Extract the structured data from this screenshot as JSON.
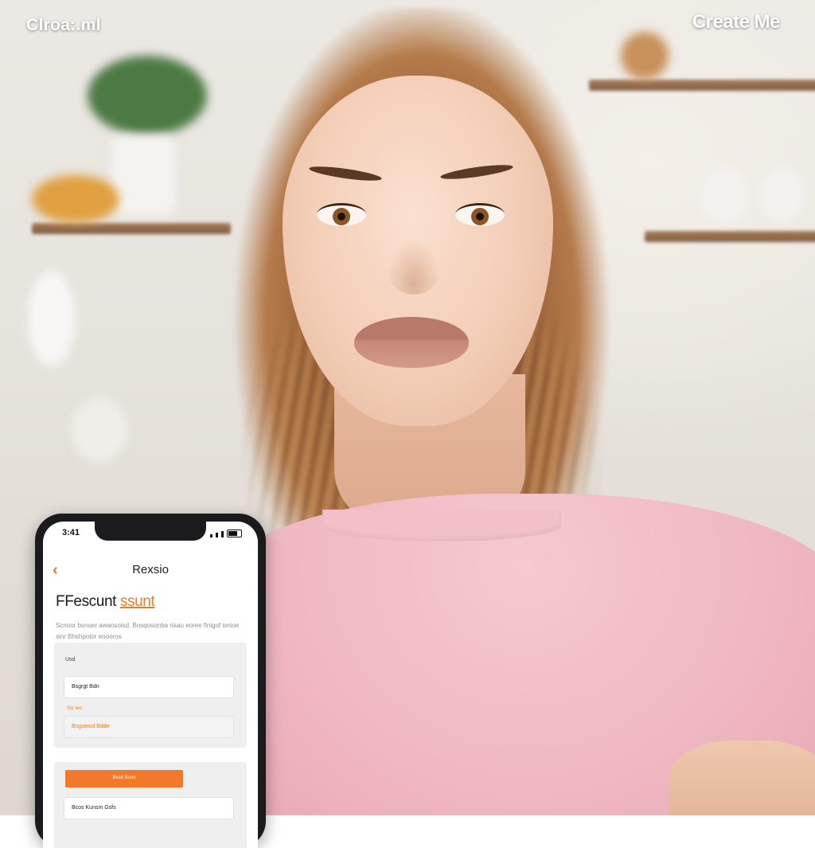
{
  "watermarks": {
    "left": "Clroa:.ml",
    "right": "Create Me"
  },
  "phone": {
    "status": {
      "time": "3:41"
    },
    "nav": {
      "back_icon": "chevron-left-icon",
      "title": "Rexsio"
    },
    "heading": {
      "main": "FFescunt ",
      "accent": "ssunt"
    },
    "description": "Scnoor bsnuer awaosoisd. Bosqosonba riaau eoree finigof isnioe sinr Bhshpotor eoooros",
    "form": {
      "section_label": "Usd",
      "field_1": "Bsgrgt Bdn",
      "hint": "Ssr ieo",
      "field_2": "Bsgsnrcd Bdde"
    },
    "action": {
      "button_label": "Bssd Bunn",
      "field_3": "Bcos Kunsm Gsfs"
    },
    "colors": {
      "accent": "#f07a23",
      "frame": "#1b1b1d"
    }
  }
}
